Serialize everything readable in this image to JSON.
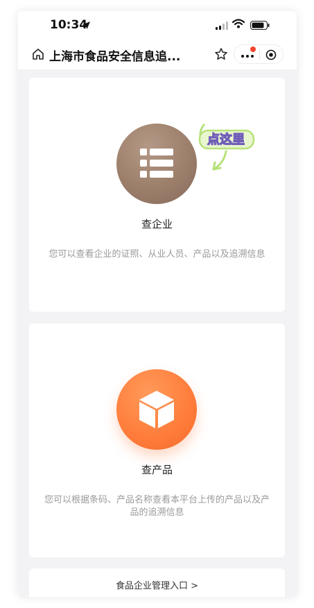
{
  "status_bar": {
    "time": "10:34"
  },
  "nav": {
    "title": "上海市食品安全信息追..."
  },
  "enterprise_card": {
    "title": "查企业",
    "description": "您可以查看企业的证照、从业人员、产品以及追溯信息",
    "hint_badge": "点这里"
  },
  "product_card": {
    "title": "查产品",
    "description": "您可以根据条码、产品名称查看本平台上传的产品以及产品的追溯信息"
  },
  "management_entry": {
    "label": "食品企业管理入口 >"
  },
  "colors": {
    "brand_brown": "#9c7f6b",
    "brand_orange": "#ff7c3a",
    "notification_red": "#f0442e"
  },
  "icons": [
    "location-arrow-icon",
    "signal-icon",
    "wifi-icon",
    "battery-icon",
    "home-icon",
    "star-icon",
    "more-icon",
    "target-icon",
    "list-icon",
    "box-icon"
  ]
}
